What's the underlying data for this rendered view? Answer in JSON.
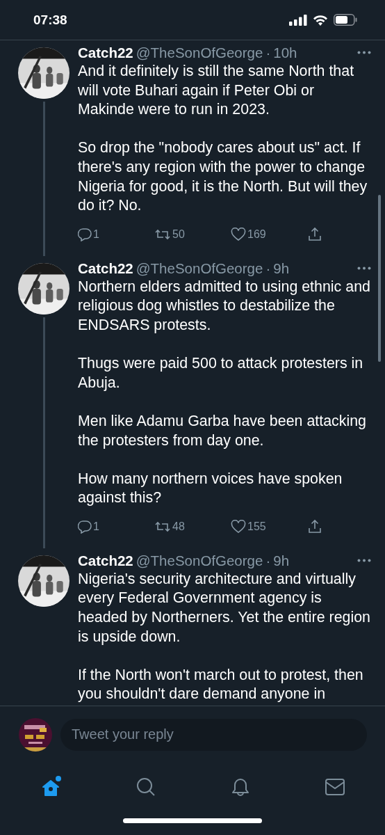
{
  "status_bar": {
    "time": "07:38"
  },
  "tweets": [
    {
      "name": "Catch22",
      "handle": "@TheSonOfGeorge",
      "separator": "·",
      "time": "10h",
      "paragraphs": [
        "And it definitely is still the same North that will vote Buhari again if Peter Obi or Makinde were to run in 2023.",
        "So drop the \"nobody cares about us\" act. If there's any region with the power to change Nigeria for good, it is the North. But will they do it? No."
      ],
      "replies": "1",
      "retweets": "50",
      "likes": "169"
    },
    {
      "name": "Catch22",
      "handle": "@TheSonOfGeorge",
      "separator": "·",
      "time": "9h",
      "paragraphs": [
        "Northern elders admitted to using ethnic and religious dog whistles to destabilize the ENDSARS protests.",
        "Thugs were paid 500 to attack protesters in Abuja.",
        "Men like Adamu Garba have been attacking the protesters from day one.",
        "How many northern voices have spoken against this?"
      ],
      "replies": "1",
      "retweets": "48",
      "likes": "155"
    },
    {
      "name": "Catch22",
      "handle": "@TheSonOfGeorge",
      "separator": "·",
      "time": "9h",
      "paragraphs": [
        "Nigeria's security architecture and virtually every Federal Government agency is headed by Northerners. Yet the entire region is upside down.",
        "If the North won't march out to protest, then you shouldn't dare demand anyone in"
      ]
    }
  ],
  "reply_box": {
    "placeholder": "Tweet your reply"
  },
  "tabs": [
    {
      "kind": "home",
      "selected": true,
      "badge": true
    },
    {
      "kind": "search",
      "selected": false
    },
    {
      "kind": "notifications",
      "selected": false
    },
    {
      "kind": "messages",
      "selected": false
    }
  ]
}
